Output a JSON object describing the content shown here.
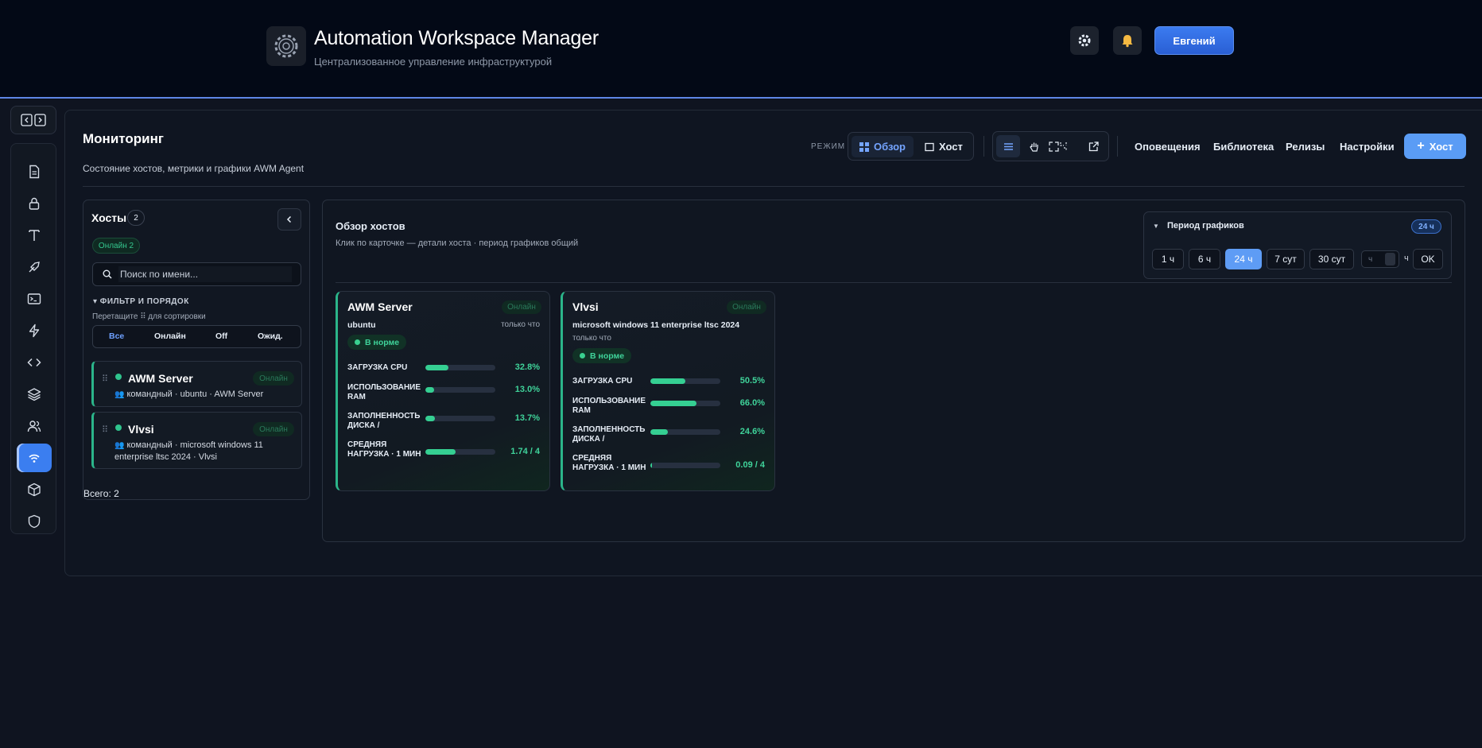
{
  "app": {
    "title": "Automation Workspace Manager",
    "subtitle": "Централизованное управление инфраструктурой",
    "user_label": "Евгений"
  },
  "page": {
    "title": "Мониторинг",
    "subtitle": "Состояние хостов, метрики и графики AWM Agent"
  },
  "toolbar": {
    "mode_label": "РЕЖИМ",
    "mode_overview": "Обзор",
    "mode_host": "Хост",
    "nav": [
      "Оповещения",
      "Библиотека",
      "Релизы",
      "Настройки"
    ],
    "add_host_label": "Хост"
  },
  "hosts_panel": {
    "title": "Хосты",
    "count": "2",
    "online_pill": "Онлайн 2",
    "search_placeholder": "Поиск по имени...",
    "filter_head": "▾ ФИЛЬТР И ПОРЯДОК",
    "filter_hint": "Перетащите ⠿ для сортировки",
    "filters": [
      "Все",
      "Онлайн",
      "Off",
      "Ожид."
    ],
    "hosts": [
      {
        "name": "AWM Server",
        "status": "Онлайн",
        "meta": "командный · ubuntu · AWM Server"
      },
      {
        "name": "Vlvsi",
        "status": "Онлайн",
        "meta": "командный · microsoft windows 11 enterprise ltsc 2024 · Vlvsi"
      }
    ],
    "total": "Всего: 2"
  },
  "overview": {
    "title": "Обзор хостов",
    "subtitle": "Клик по карточке — детали хоста · период графиков общий",
    "period": {
      "title": "Период графиков",
      "badge": "24 ч",
      "options": [
        "1 ч",
        "6 ч",
        "24 ч",
        "7 сут",
        "30 сут"
      ],
      "selected": "24 ч",
      "custom_placeholder": "ч",
      "unit": "ч",
      "ok": "OK"
    },
    "cards": [
      {
        "name": "AWM Server",
        "status": "Онлайн",
        "os": "ubuntu",
        "updated": "только что",
        "health": "В норме",
        "metrics": [
          {
            "label": "ЗАГРУЗКА CPU",
            "value": "32.8%",
            "fraction": 0.328
          },
          {
            "label": "ИСПОЛЬЗОВАНИЕ RAM",
            "value": "13.0%",
            "fraction": 0.13
          },
          {
            "label": "ЗАПОЛНЕННОСТЬ ДИСКА /",
            "value": "13.7%",
            "fraction": 0.137
          },
          {
            "label": "СРЕДНЯЯ НАГРУЗКА · 1 МИН",
            "value": "1.74 / 4",
            "fraction": 0.435
          }
        ]
      },
      {
        "name": "Vlvsi",
        "status": "Онлайн",
        "os": "microsoft windows 11 enterprise ltsc 2024",
        "updated": "только что",
        "health": "В норме",
        "metrics": [
          {
            "label": "ЗАГРУЗКА CPU",
            "value": "50.5%",
            "fraction": 0.505
          },
          {
            "label": "ИСПОЛЬЗОВАНИЕ RAM",
            "value": "66.0%",
            "fraction": 0.66
          },
          {
            "label": "ЗАПОЛНЕННОСТЬ ДИСКА /",
            "value": "24.6%",
            "fraction": 0.246
          },
          {
            "label": "СРЕДНЯЯ НАГРУЗКА · 1 МИН",
            "value": "0.09 / 4",
            "fraction": 0.0225
          }
        ]
      }
    ]
  },
  "colors": {
    "accent": "#3b7ef0",
    "online": "#2fc48d",
    "bg": "#0f1420"
  }
}
